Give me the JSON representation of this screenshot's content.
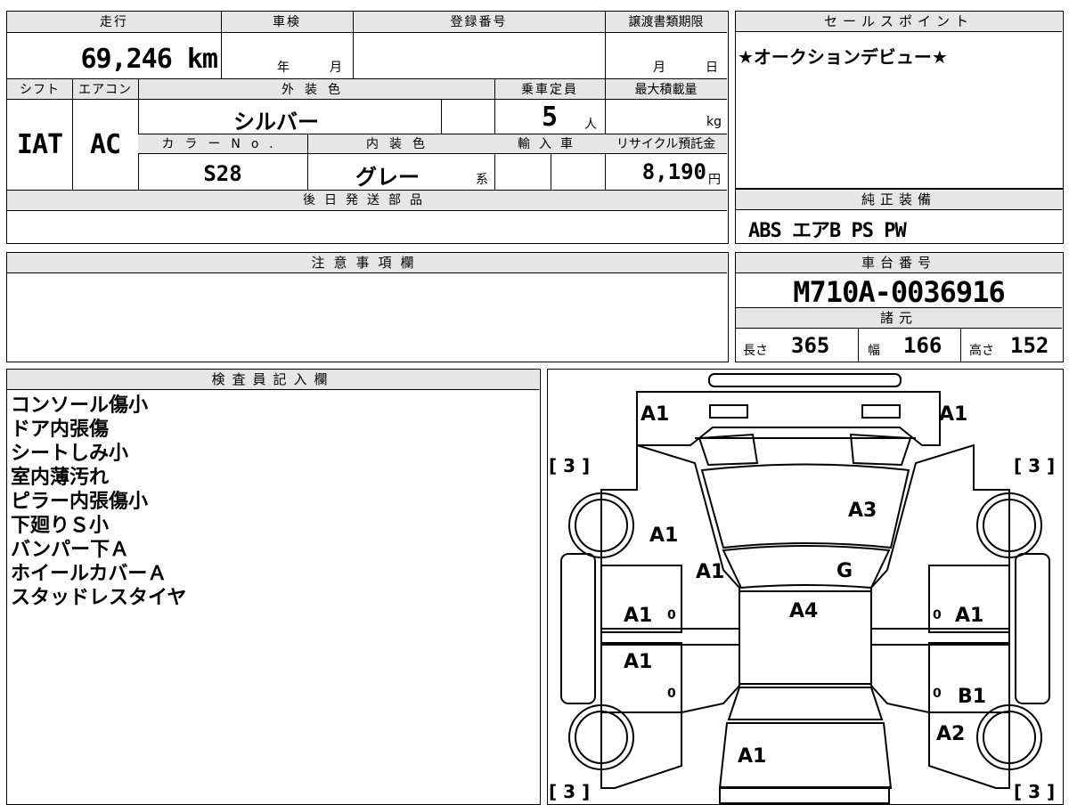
{
  "top_info": {
    "mileage_label": "走行",
    "mileage_value": "69,246 km",
    "inspection_label": "車検",
    "inspection_year_unit": "年",
    "inspection_month_unit": "月",
    "registration_label": "登録番号",
    "transfer_deadline_label": "譲渡書類期限",
    "transfer_month_unit": "月",
    "transfer_day_unit": "日",
    "shift_label": "シフト",
    "shift_value": "IAT",
    "aircon_label": "エアコン",
    "aircon_value": "AC",
    "exterior_color_label": "外装色",
    "exterior_color_value": "シルバー",
    "capacity_label": "乗車定員",
    "capacity_value": "5",
    "capacity_unit": "人",
    "max_load_label": "最大積載量",
    "max_load_unit": "kg",
    "color_no_label": "カラーNo.",
    "color_no_value": "S28",
    "interior_color_label": "内装色",
    "interior_color_value": "グレー",
    "interior_color_suffix": "系",
    "import_label": "輸入車",
    "recycle_label": "リサイクル預託金",
    "recycle_value": "8,190",
    "recycle_unit": "円",
    "later_parts_label": "後日発送部品"
  },
  "sales_point": {
    "label": "セールスポイント",
    "text": "★オークションデビュー★"
  },
  "equipment": {
    "label": "純正装備",
    "text": "ABS エアB PS PW"
  },
  "caution": {
    "label": "注意事項欄"
  },
  "chassis": {
    "label": "車台番号",
    "value": "M710A-0036916"
  },
  "specs": {
    "label": "諸元",
    "length_label": "長さ",
    "length_value": "365",
    "width_label": "幅",
    "width_value": "166",
    "height_label": "高さ",
    "height_value": "152"
  },
  "inspector": {
    "label": "検査員記入欄",
    "notes": [
      "コンソール傷小",
      "ドア内張傷",
      "シートしみ小",
      "室内薄汚れ",
      "ピラー内張傷小",
      "下廻りＳ小",
      "バンパー下Ａ",
      "ホイールカバーＡ",
      "スタッドレスタイヤ"
    ]
  },
  "diagram": {
    "marks": {
      "front_left": "A1",
      "front_right": "A1",
      "hood": "A3",
      "left_fender": "A1",
      "left_pillar": "A1",
      "windshield": "G",
      "roof": "A4",
      "left_front_door": "A1",
      "right_front_door": "A1",
      "left_rear_door": "A1",
      "right_rear_door": "B1",
      "right_rear_fender": "A2",
      "rear": "A1"
    },
    "tire_labels": {
      "front_left": "[ 3 ]",
      "front_right": "[ 3 ]",
      "rear_left": "[ 3 ]",
      "rear_right": "[ 3 ]"
    },
    "door_markers": [
      "0",
      "0",
      "0",
      "0"
    ]
  }
}
